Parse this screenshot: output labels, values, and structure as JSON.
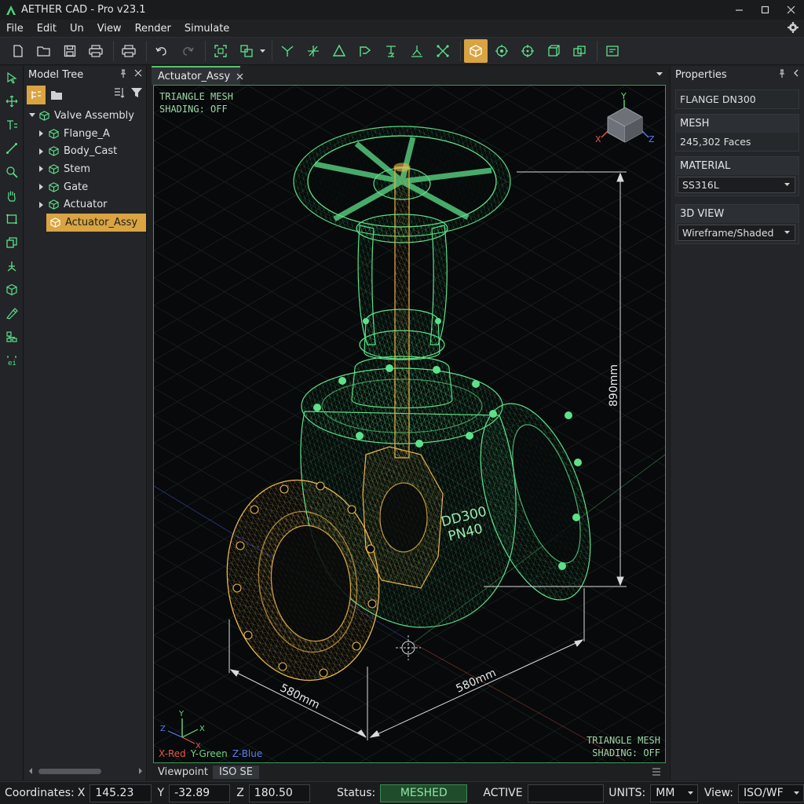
{
  "window": {
    "title": "AETHER CAD - Pro v23.1"
  },
  "menu": [
    "File",
    "Edit",
    "Un",
    "View",
    "Render",
    "Simulate"
  ],
  "colors": {
    "accent": "#d9a441",
    "wire_green": "#5ee08a",
    "wire_gold": "#e8b54a",
    "status_green": "#1f4d2c",
    "axis_x": "#e5574d",
    "axis_y": "#6fd67f",
    "axis_z": "#5b7cf0"
  },
  "model_tree": {
    "title": "Model Tree",
    "items": [
      {
        "label": "Valve Assembly",
        "level": 0
      },
      {
        "label": "Flange_A",
        "level": 1
      },
      {
        "label": "Body_Cast",
        "level": 1
      },
      {
        "label": "Stem",
        "level": 1
      },
      {
        "label": "Gate",
        "level": 1
      },
      {
        "label": "Actuator",
        "level": 1
      },
      {
        "label": "Actuator_Assy",
        "level": 1,
        "selected": true
      }
    ]
  },
  "document": {
    "tab_label": "Actuator_Assy"
  },
  "viewport": {
    "overlay_top_left": [
      "TRIANGLE MESH",
      "SHADING: OFF"
    ],
    "overlay_bottom_right": [
      "TRIANGLE MESH",
      "SHADING: OFF"
    ],
    "dimensions": {
      "height": "890mm",
      "width_left": "580mm",
      "width_right": "580mm"
    },
    "body_label": [
      "DD300",
      "PN40"
    ],
    "axes_legend": {
      "x": "X-Red",
      "y": "Y-Green",
      "z": "Z-Blue"
    },
    "gizmo": {
      "x": "X",
      "y": "Y",
      "z": "Z"
    }
  },
  "viewpoint": {
    "label": "Viewpoint",
    "value": "ISO SE"
  },
  "properties": {
    "title": "Properties",
    "name": "FLANGE DN300",
    "mesh_label": "MESH",
    "mesh_value": "245,302 Faces",
    "material_label": "MATERIAL",
    "material_value": "SS316L",
    "view_label": "3D VIEW",
    "view_value": "Wireframe/Shaded"
  },
  "status": {
    "coords_label": "Coordinates:",
    "x_label": "X",
    "x_value": "145.23",
    "y_label": "Y",
    "y_value": "-32.89",
    "z_label": "Z",
    "z_value": "180.50",
    "status_label": "Status:",
    "status_value": "MESHED",
    "active_label": "ACTIVE",
    "units_label": "UNITS:",
    "units_value": "MM",
    "view_label": "View:",
    "view_value": "ISO/WF"
  }
}
